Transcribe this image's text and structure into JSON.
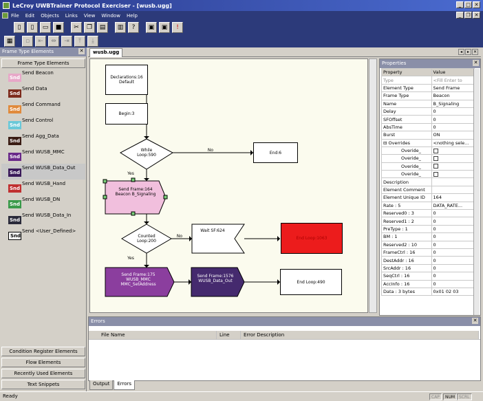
{
  "app": {
    "title": "LeCroy UWBTrainer Protocol Exerciser - [wusb.ugg]"
  },
  "menu": [
    "File",
    "Edit",
    "Objects",
    "Links",
    "View",
    "Window",
    "Help"
  ],
  "left_panel": {
    "title": "Frame Type Elements",
    "subheader": "Frame Type Elements",
    "items": [
      {
        "label": "Send Beacon",
        "icon": "send-beacon-icon",
        "color": "#e7a8c8",
        "glyph": "Snd"
      },
      {
        "label": "Send Data",
        "icon": "send-data-icon",
        "color": "#7d2b1c",
        "glyph": "Snd"
      },
      {
        "label": "Send Command",
        "icon": "send-command-icon",
        "color": "#e08a3c",
        "glyph": "Snd"
      },
      {
        "label": "Send Control",
        "icon": "send-control-icon",
        "color": "#6ac8d8",
        "glyph": "Snd"
      },
      {
        "label": "Send Agg_Data",
        "icon": "send-agg-data-icon",
        "color": "#3a1c14",
        "glyph": "Snd"
      },
      {
        "label": "Send WUSB_MMC",
        "icon": "send-wusb-mmc-icon",
        "color": "#6a2a8a",
        "glyph": "Snd"
      },
      {
        "label": "Send WUSB_Data_Out",
        "icon": "send-wusb-data-out-icon",
        "color": "#3a1a5a",
        "glyph": "Snd"
      },
      {
        "label": "Send WUSB_Hand",
        "icon": "send-wusb-hand-icon",
        "color": "#c03030",
        "glyph": "Snd"
      },
      {
        "label": "Send WUSB_DN",
        "icon": "send-wusb-dn-icon",
        "color": "#3a9a4a",
        "glyph": "Snd"
      },
      {
        "label": "Send WUSB_Data_In",
        "icon": "send-wusb-data-in-icon",
        "color": "#2a2a3a",
        "glyph": "Snd"
      },
      {
        "label": "Send <User_Defined>",
        "icon": "send-user-defined-icon",
        "color": "#ffffff",
        "glyph": "Snd"
      }
    ],
    "bottom_buttons": [
      "Condition Register Elements",
      "Flow Elements",
      "Recently Used Elements",
      "Text Snippets"
    ]
  },
  "doc": {
    "tab": "wusb.ugg"
  },
  "flow": {
    "declarations": "Declarations:16\nDefault",
    "begin": "Begin:3",
    "while": "While\nLoop:590",
    "no_label": "No",
    "end": "End:6",
    "yes_label": "Yes",
    "send_frame_1": "Send Frame:164\nBeacon B_Signaling",
    "counted": "Counted\nLoop:200",
    "no_label2": "No",
    "wait": "Wait SF:624",
    "end_loop_red": "End Loop:1063",
    "yes_label2": "Yes",
    "send_frame_2": "Send Frame:175\nWUSB_MMC\nMMC_SetAddress",
    "send_frame_3": "Send Frame:1576\nWUSB_Data_Out",
    "end_loop": "End Loop:490"
  },
  "properties": {
    "title": "Properties",
    "col_property": "Property",
    "col_value": "Value",
    "rows": [
      [
        "Type",
        "<Fill Enter to"
      ],
      [
        "Element Type",
        "Send Frame"
      ],
      [
        "Frame Type",
        "Beacon"
      ],
      [
        "Name",
        "B_Signaling"
      ],
      [
        "Delay",
        "0"
      ],
      [
        "SFOffset",
        "0"
      ],
      [
        "AbsTime",
        "0"
      ],
      [
        "Burst",
        "ON"
      ],
      [
        "⊟ Overrides",
        "<nothing sele..."
      ],
      [
        "Overide_",
        ""
      ],
      [
        "Overide_",
        ""
      ],
      [
        "Overide_",
        ""
      ],
      [
        "Overide_",
        ""
      ],
      [
        "Description",
        ""
      ],
      [
        "Element Comment",
        ""
      ],
      [
        "Element Unique ID",
        "164"
      ],
      [
        "Rate : 5",
        "DATA_RATE..."
      ],
      [
        "Reserved0 : 3",
        "0"
      ],
      [
        "Reserved1 : 2",
        "0"
      ],
      [
        "PreType : 1",
        "0"
      ],
      [
        "BM : 1",
        "0"
      ],
      [
        "Reserved2 : 10",
        "0"
      ],
      [
        "FrameCtrl : 16",
        "0"
      ],
      [
        "DestAddr : 16",
        "0"
      ],
      [
        "SrcAddr : 16",
        "0"
      ],
      [
        "SeqCtrl : 16",
        "0"
      ],
      [
        "AccInfo : 16",
        "0"
      ],
      [
        "Data : 3 bytes",
        "0x01 02 03"
      ]
    ]
  },
  "errors": {
    "title": "Errors",
    "cols": [
      "File Name",
      "Line",
      "Error Description"
    ],
    "tabs": [
      "Output",
      "Errors"
    ]
  },
  "status": {
    "text": "Ready",
    "ind1": "CAP",
    "ind2": "NUM",
    "ind3": "SCRL"
  }
}
